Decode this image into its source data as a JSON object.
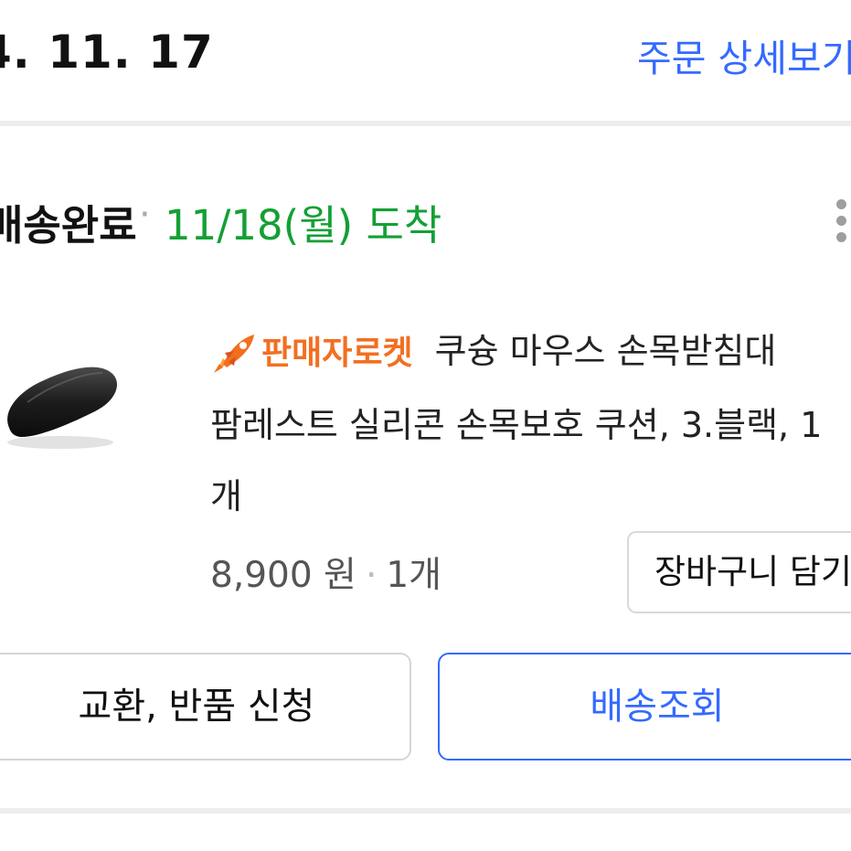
{
  "order": {
    "date": "4. 11. 17",
    "detail_link": "주문 상세보기"
  },
  "shipment": {
    "status": "배송완료",
    "separator": "·",
    "arrival": "11/18(월) 도착"
  },
  "product": {
    "badge_label": "판매자로켓",
    "title_line1": "쿠슝 마우스 손목받침대",
    "title_line2": "팜레스트 실리콘 손목보호 쿠션, 3.블랙, 1",
    "title_line3": "개",
    "price": "8,900 원",
    "price_separator": "·",
    "quantity": "1개",
    "image_icon": "mouse-wrist-rest-image"
  },
  "actions": {
    "cart_label": "장바구니 담기",
    "exchange_label": "교환, 반품 신청",
    "tracking_label": "배송조회"
  },
  "colors": {
    "link_blue": "#346aff",
    "arrival_green": "#13a034",
    "rocket_orange": "#f26f21"
  }
}
